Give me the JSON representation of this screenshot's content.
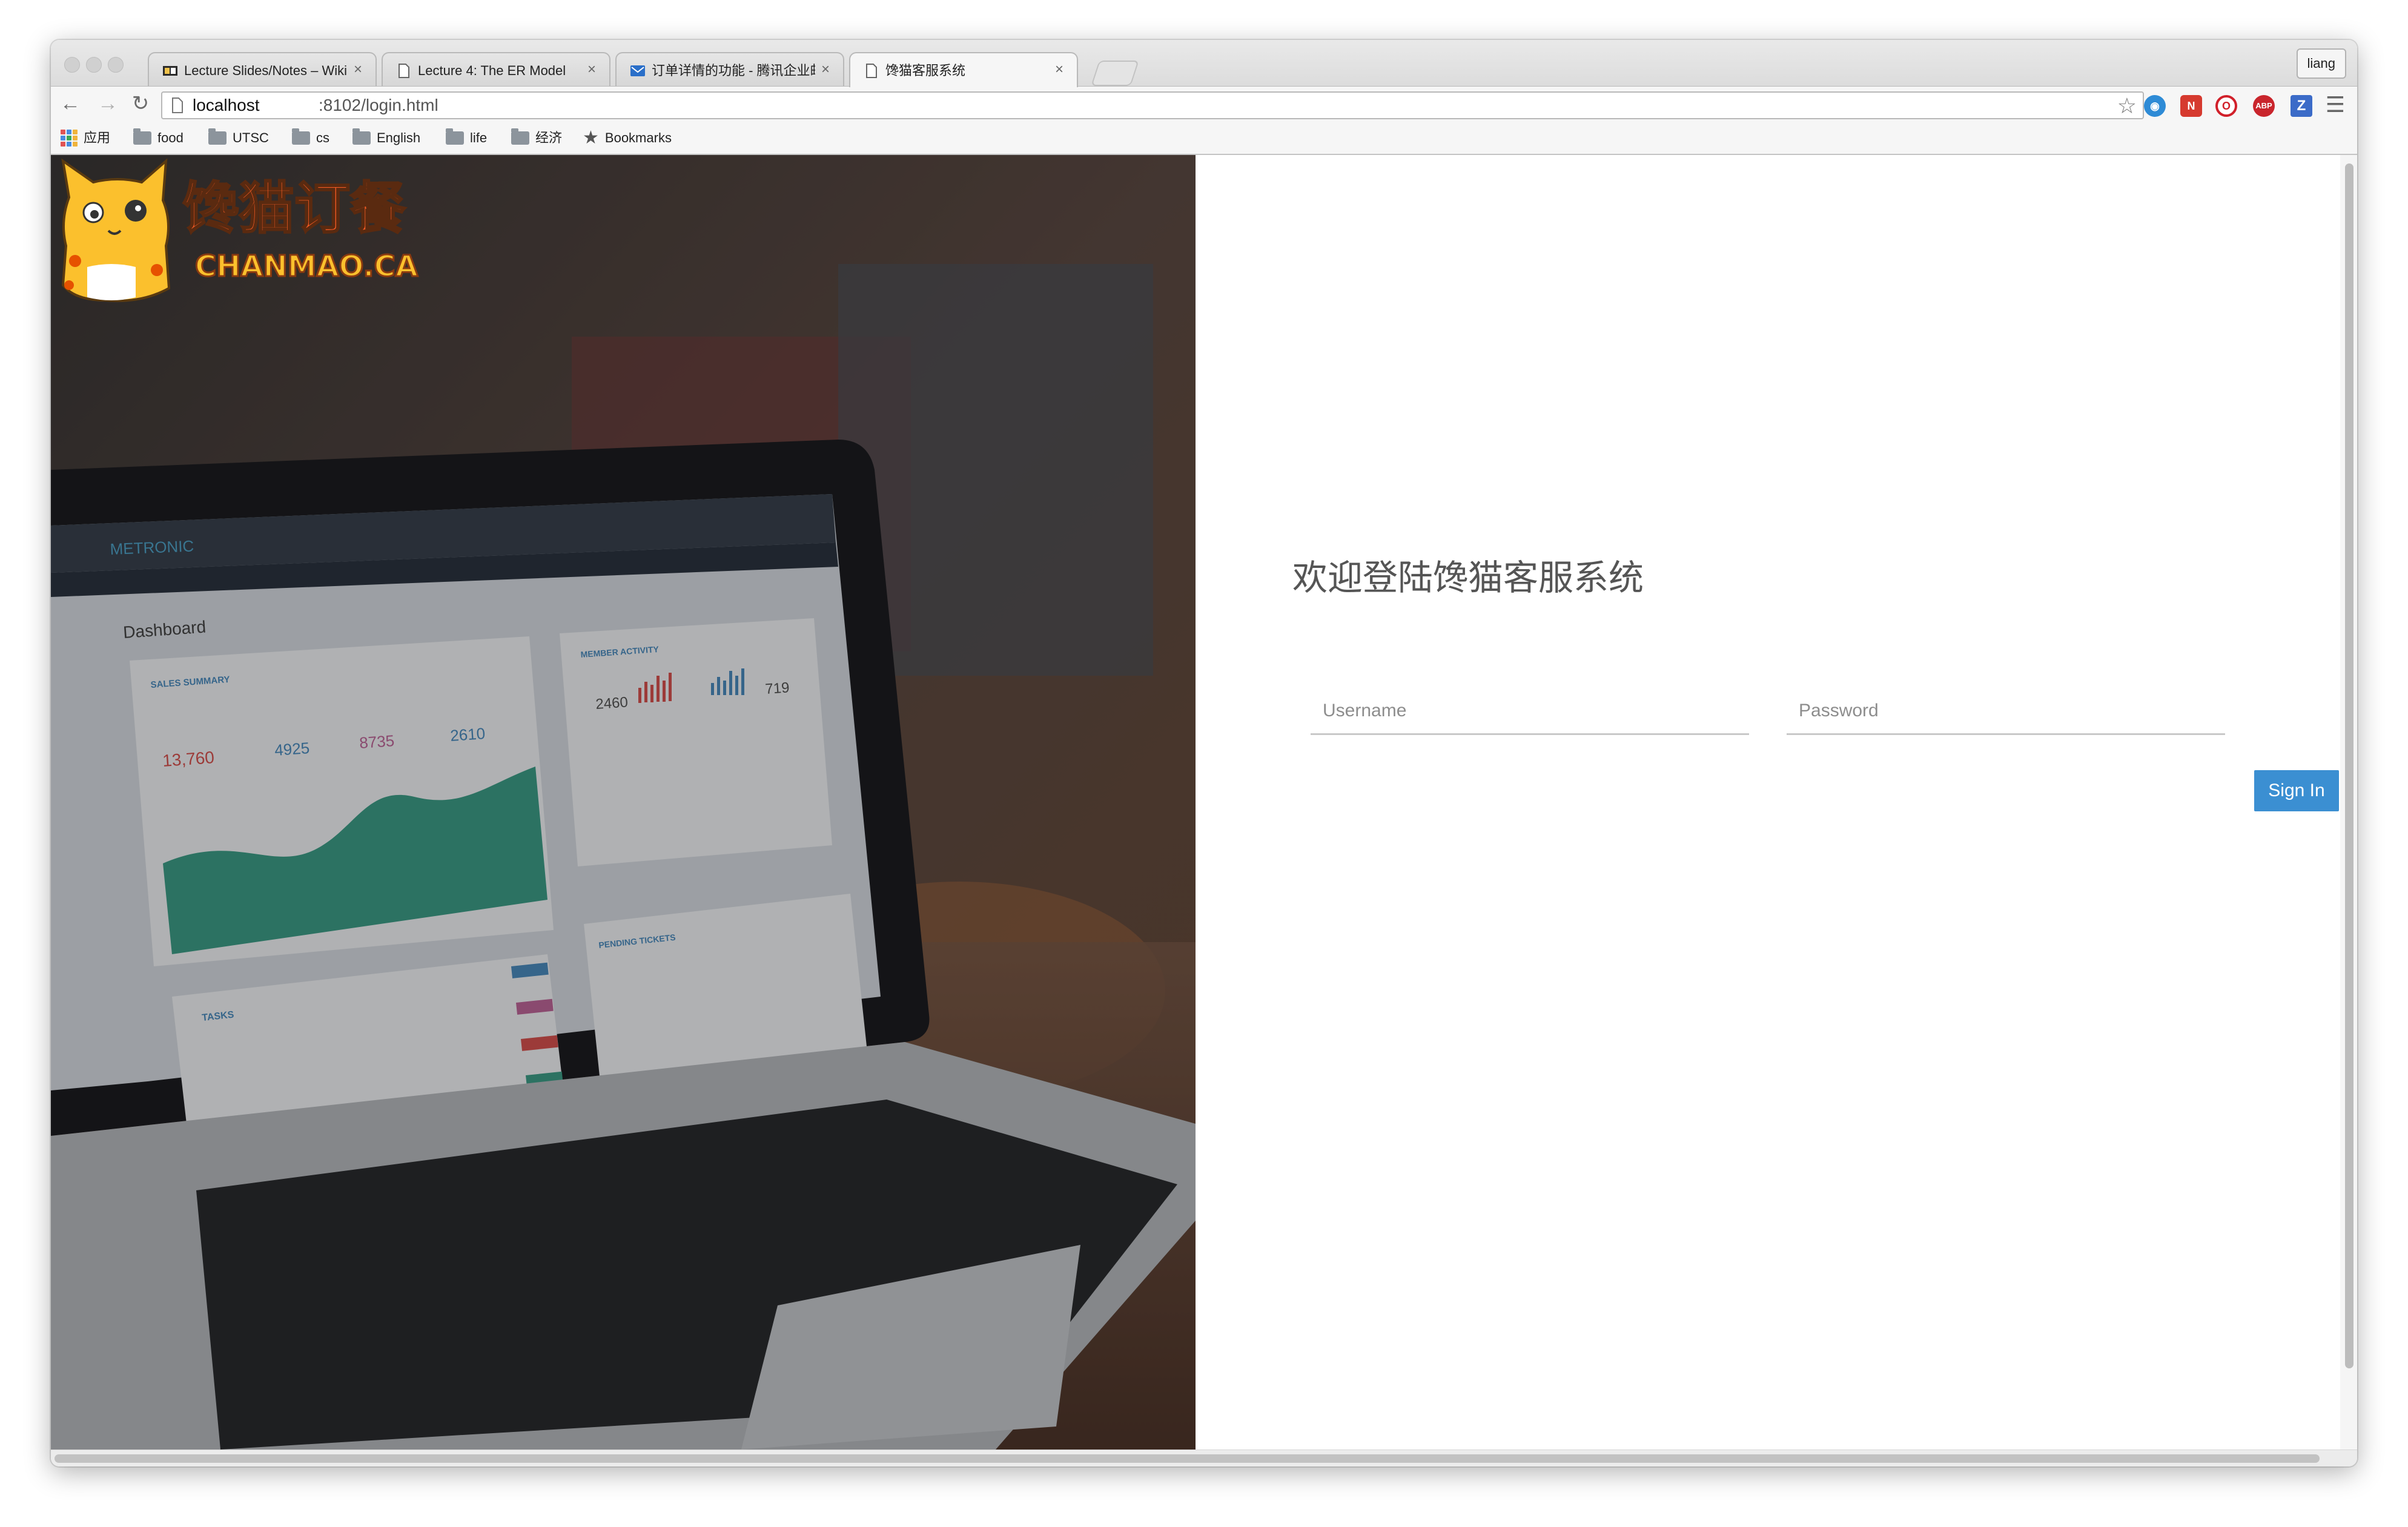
{
  "browser": {
    "tabs": [
      {
        "title": "Lecture Slides/Notes – Wiki",
        "favicon": "wiki-favicon",
        "close": "×",
        "active": false
      },
      {
        "title": "Lecture 4: The ER Model",
        "favicon": "document-favicon",
        "close": "×",
        "active": false
      },
      {
        "title": "订单详情的功能 - 腾讯企业邮",
        "favicon": "mail-favicon",
        "close": "×",
        "active": false
      },
      {
        "title": "馋猫客服系统",
        "favicon": "document-favicon",
        "close": "×",
        "active": true
      }
    ],
    "profile_label": "liang",
    "url_host": "localhost",
    "url_path": ":8102/login.html",
    "extensions": [
      "globe-icon",
      "new-badge-icon",
      "opera-icon",
      "adblock-plus-icon",
      "z-extension-icon"
    ],
    "bookmarks": [
      {
        "label": "应用",
        "icon": "apps-grid-icon"
      },
      {
        "label": "food",
        "icon": "folder-icon"
      },
      {
        "label": "UTSC",
        "icon": "folder-icon"
      },
      {
        "label": "cs",
        "icon": "folder-icon"
      },
      {
        "label": "English",
        "icon": "folder-icon"
      },
      {
        "label": "life",
        "icon": "folder-icon"
      },
      {
        "label": "经济",
        "icon": "folder-icon"
      },
      {
        "label": "Bookmarks",
        "icon": "star-icon"
      }
    ]
  },
  "hero": {
    "logo_cn": "馋猫订餐",
    "logo_en": "CHANMAO.CA",
    "dashboard_brand": "METRONIC",
    "dashboard_title": "Dashboard",
    "sales_summary": "SALES SUMMARY",
    "member_activity": "MEMBER ACTIVITY",
    "total_sales": "13,760",
    "profit": "4925",
    "expenses": "8735",
    "growth": "2610",
    "members_total": "2460",
    "members_new": "719",
    "tasks_label": "TASKS",
    "pending_tickets": "PENDING TICKETS"
  },
  "login": {
    "title": "欢迎登陆馋猫客服系统",
    "username_placeholder": "Username",
    "password_placeholder": "Password",
    "signin_label": "Sign In"
  },
  "colors": {
    "signin_button": "#3b8fd2",
    "logo_orange": "#f15a24",
    "logo_yellow": "#fbc02d",
    "chart_teal": "#3e9e88",
    "chart_red": "#d9534f"
  }
}
